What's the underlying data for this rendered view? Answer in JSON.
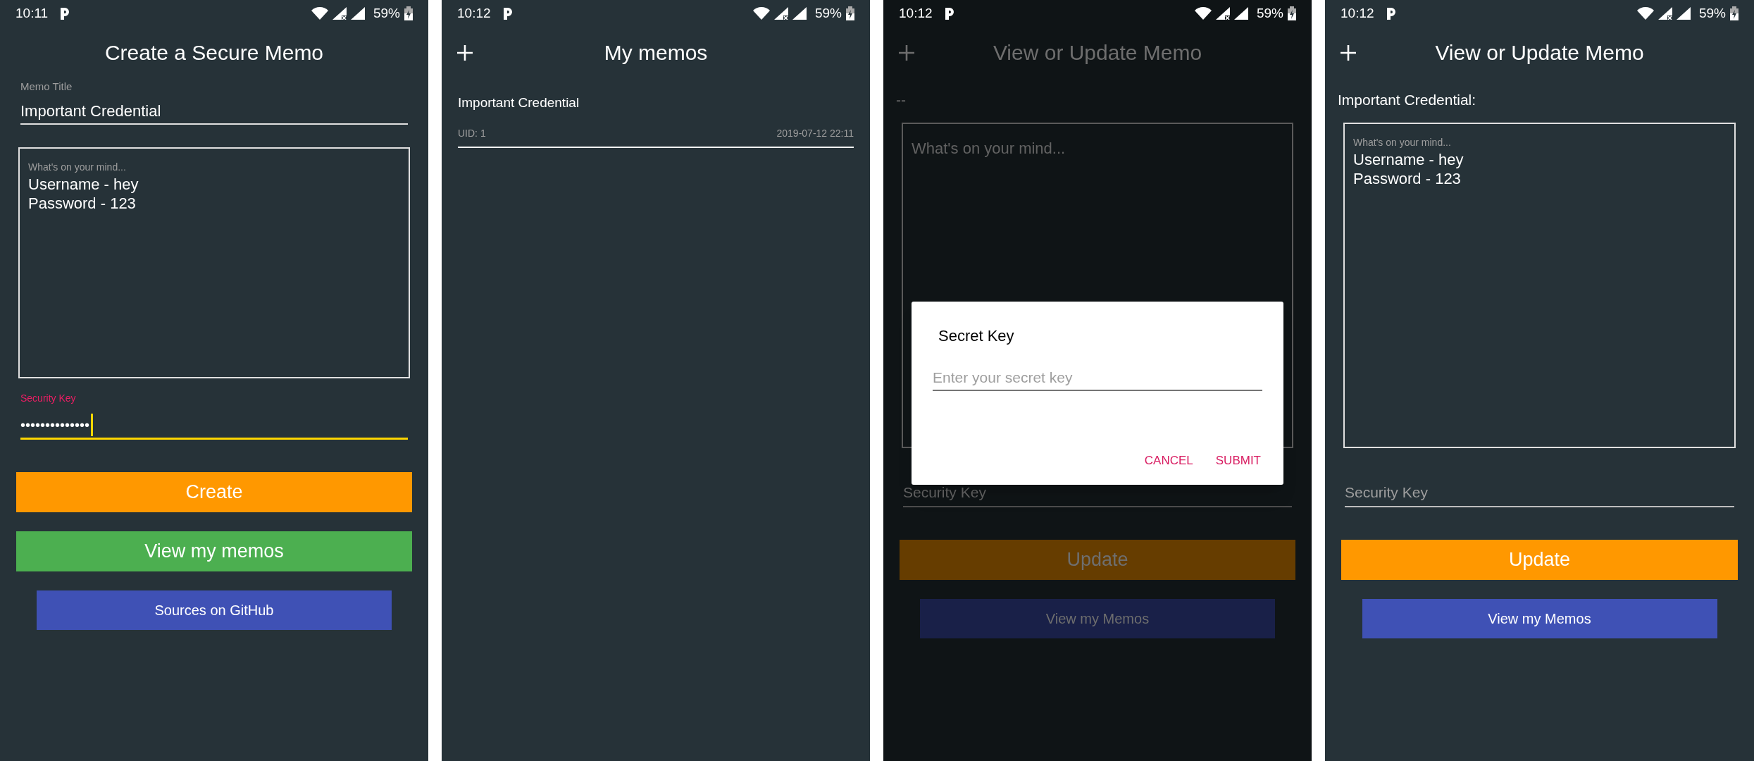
{
  "screens": [
    {
      "kind": "create",
      "status_bar": {
        "time": "10:11",
        "battery": "59%"
      },
      "title": "Create a Secure Memo",
      "title_field": {
        "label": "Memo Title",
        "value": "Important Credential"
      },
      "memo_field": {
        "label": "What's on your mind...",
        "value": "Username - hey\nPassword - 123"
      },
      "key_field": {
        "label": "Security Key",
        "value": "••••••••••••••",
        "focused": true
      },
      "buttons": [
        {
          "label": "Create",
          "kind": "large",
          "color": "#ff9800"
        },
        {
          "label": "View my memos",
          "kind": "large",
          "color": "#4caf50"
        },
        {
          "label": "Sources on GitHub",
          "kind": "small",
          "color": "#3f51b5"
        }
      ]
    },
    {
      "kind": "list",
      "status_bar": {
        "time": "10:12",
        "battery": "59%"
      },
      "title": "My memos",
      "memos": [
        {
          "title": "Important Credential",
          "uid": "UID: 1",
          "date": "2019-07-12 22:11"
        }
      ]
    },
    {
      "kind": "view",
      "status_bar": {
        "time": "10:12",
        "battery": "59%"
      },
      "title": "View or Update Memo",
      "dimmed": true,
      "heading": "--",
      "memo_field": {
        "placeholder": "What's on your mind..."
      },
      "key_field": {
        "placeholder": "Security Key"
      },
      "buttons": [
        {
          "label": "Update",
          "kind": "large",
          "color": "#663d00"
        },
        {
          "label": "View my Memos",
          "kind": "small",
          "color": "#192048"
        }
      ],
      "dialog": {
        "title": "Secret Key",
        "input": {
          "placeholder": "Enter your secret key"
        },
        "actions": [
          "CANCEL",
          "SUBMIT"
        ]
      }
    },
    {
      "kind": "view",
      "status_bar": {
        "time": "10:12",
        "battery": "59%"
      },
      "title": "View or Update Memo",
      "dimmed": false,
      "heading": "Important Credential:",
      "memo_field": {
        "label": "What's on your mind...",
        "value": "Username - hey\nPassword - 123"
      },
      "key_field": {
        "placeholder": "Security Key"
      },
      "buttons": [
        {
          "label": "Update",
          "kind": "large",
          "color": "#ff9800"
        },
        {
          "label": "View my Memos",
          "kind": "small",
          "color": "#3f51b5"
        }
      ]
    }
  ]
}
